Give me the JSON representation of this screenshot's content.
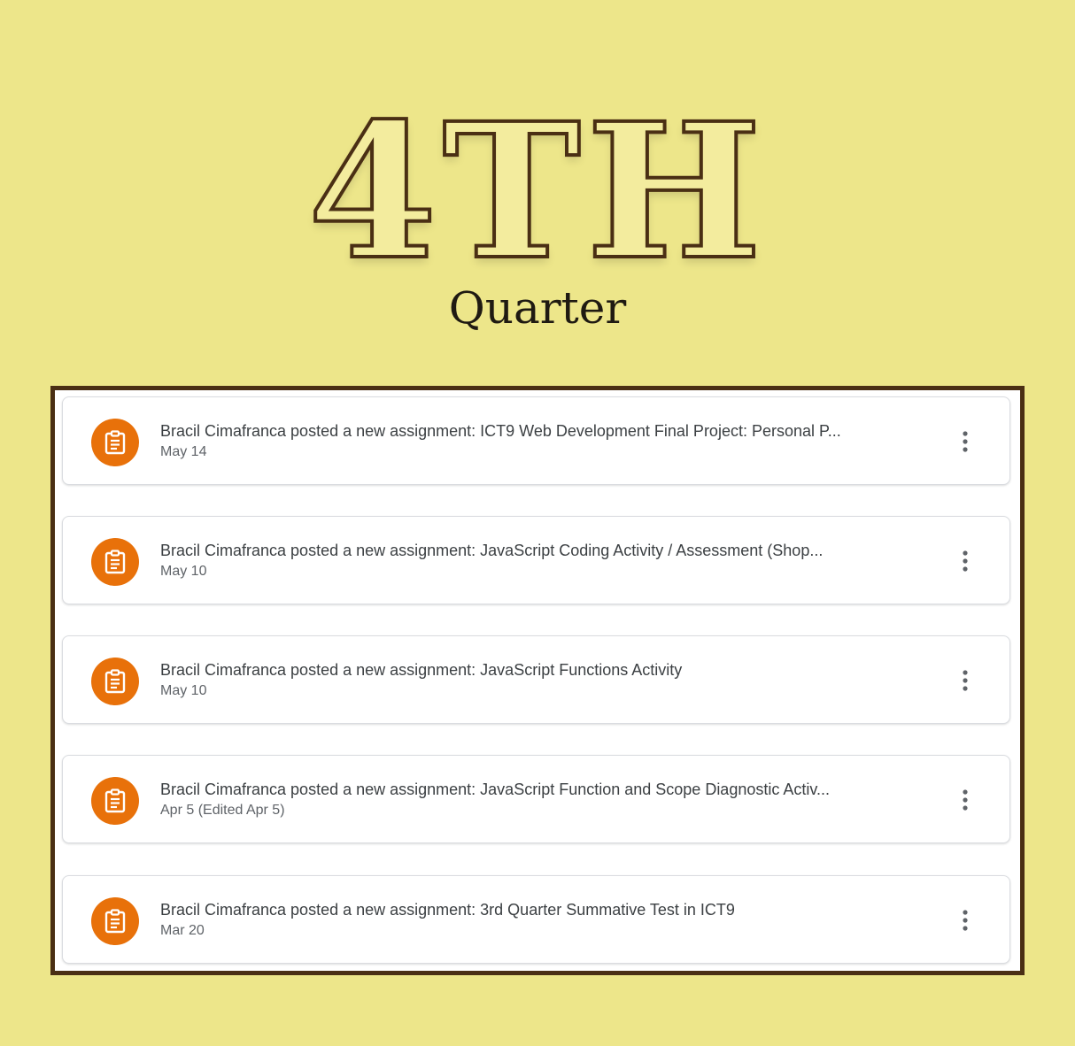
{
  "header": {
    "title": "4TH",
    "subtitle": "Quarter"
  },
  "theme": {
    "background": "#ede68a",
    "frame_border": "#4a2f14",
    "assignment_icon_bg": "#e8710a"
  },
  "stream": {
    "items": [
      {
        "title": "Bracil Cimafranca posted a new assignment: ICT9 Web Development Final Project: Personal P...",
        "date": "May 14",
        "icon": "assignment-icon",
        "menu_icon": "more-vert-icon"
      },
      {
        "title": "Bracil Cimafranca posted a new assignment: JavaScript Coding Activity / Assessment (Shop...",
        "date": "May 10",
        "icon": "assignment-icon",
        "menu_icon": "more-vert-icon"
      },
      {
        "title": "Bracil Cimafranca posted a new assignment: JavaScript Functions Activity",
        "date": "May 10",
        "icon": "assignment-icon",
        "menu_icon": "more-vert-icon"
      },
      {
        "title": "Bracil Cimafranca posted a new assignment: JavaScript Function and Scope Diagnostic Activ...",
        "date": "Apr 5 (Edited Apr 5)",
        "icon": "assignment-icon",
        "menu_icon": "more-vert-icon"
      },
      {
        "title": "Bracil Cimafranca posted a new assignment: 3rd Quarter Summative Test in ICT9",
        "date": "Mar 20",
        "icon": "assignment-icon",
        "menu_icon": "more-vert-icon"
      }
    ]
  }
}
